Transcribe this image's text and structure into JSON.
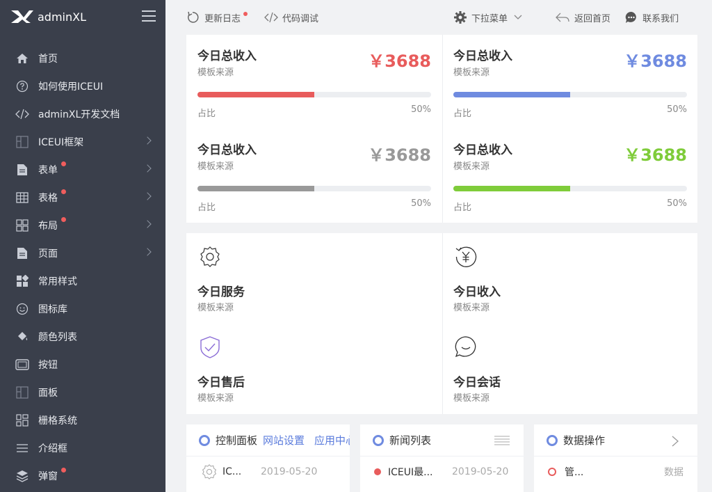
{
  "brand": {
    "name": "adminXL"
  },
  "sidebar": {
    "items": [
      {
        "label": "首页",
        "icon": "home-icon",
        "dot": false,
        "arrow": false
      },
      {
        "label": "如何使用ICEUI",
        "icon": "help-circle-icon",
        "dot": false,
        "arrow": false
      },
      {
        "label": "adminXL开发文档",
        "icon": "code-icon",
        "dot": false,
        "arrow": false
      },
      {
        "label": "ICEUI框架",
        "icon": "grid-icon",
        "dot": false,
        "arrow": true
      },
      {
        "label": "表单",
        "icon": "document-icon",
        "dot": true,
        "arrow": true
      },
      {
        "label": "表格",
        "icon": "table-icon",
        "dot": true,
        "arrow": true
      },
      {
        "label": "布局",
        "icon": "layout-icon",
        "dot": true,
        "arrow": true
      },
      {
        "label": "页面",
        "icon": "page-icon",
        "dot": false,
        "arrow": true
      },
      {
        "label": "常用样式",
        "icon": "apps-icon",
        "dot": false,
        "arrow": false
      },
      {
        "label": "图标库",
        "icon": "smile-icon",
        "dot": false,
        "arrow": false
      },
      {
        "label": "颜色列表",
        "icon": "paint-bucket-icon",
        "dot": false,
        "arrow": false
      },
      {
        "label": "按钮",
        "icon": "button-icon",
        "dot": false,
        "arrow": false
      },
      {
        "label": "面板",
        "icon": "panel-icon",
        "dot": false,
        "arrow": false
      },
      {
        "label": "栅格系统",
        "icon": "grid-system-icon",
        "dot": false,
        "arrow": false
      },
      {
        "label": "介绍框",
        "icon": "list-icon",
        "dot": false,
        "arrow": false
      },
      {
        "label": "弹窗",
        "icon": "layers-icon",
        "dot": true,
        "arrow": false
      }
    ]
  },
  "topbar": {
    "changelog": "更新日志",
    "debug": "代码调试",
    "dropdown": "下拉菜单",
    "home": "返回首页",
    "contact": "联系我们"
  },
  "stats": [
    {
      "title": "今日总收入",
      "sub": "模板来源",
      "amount": "￥3688",
      "label": "占比",
      "percent_text": "50%",
      "progress": 0.5,
      "color": "#e85c5c"
    },
    {
      "title": "今日总收入",
      "sub": "模板来源",
      "amount": "￥3688",
      "label": "占比",
      "percent_text": "50%",
      "progress": 0.5,
      "color": "#6f8be0"
    },
    {
      "title": "今日总收入",
      "sub": "模板来源",
      "amount": "￥3688",
      "label": "占比",
      "percent_text": "50%",
      "progress": 0.5,
      "color": "#999999"
    },
    {
      "title": "今日总收入",
      "sub": "模板来源",
      "amount": "￥3688",
      "label": "占比",
      "percent_text": "50%",
      "progress": 0.5,
      "color": "#7fcc3a"
    }
  ],
  "services": [
    {
      "title": "今日服务",
      "sub": "模板来源",
      "icon": "gear-icon"
    },
    {
      "title": "今日收入",
      "sub": "模板来源",
      "icon": "yen-refresh-icon"
    },
    {
      "title": "今日售后",
      "sub": "模板来源",
      "icon": "shield-check-icon"
    },
    {
      "title": "今日会话",
      "sub": "模板来源",
      "icon": "chat-bubble-icon"
    }
  ],
  "cards": {
    "control": {
      "title": "控制面板",
      "tabs": [
        "网站设置",
        "应用中心"
      ],
      "row_text": "IC...",
      "row_date": "2019-05-20"
    },
    "news": {
      "title": "新闻列表",
      "row_text": "ICEUI最...",
      "row_date": "2019-05-20"
    },
    "data": {
      "title": "数据操作",
      "row_text": "管...",
      "row_right": "数据"
    }
  }
}
